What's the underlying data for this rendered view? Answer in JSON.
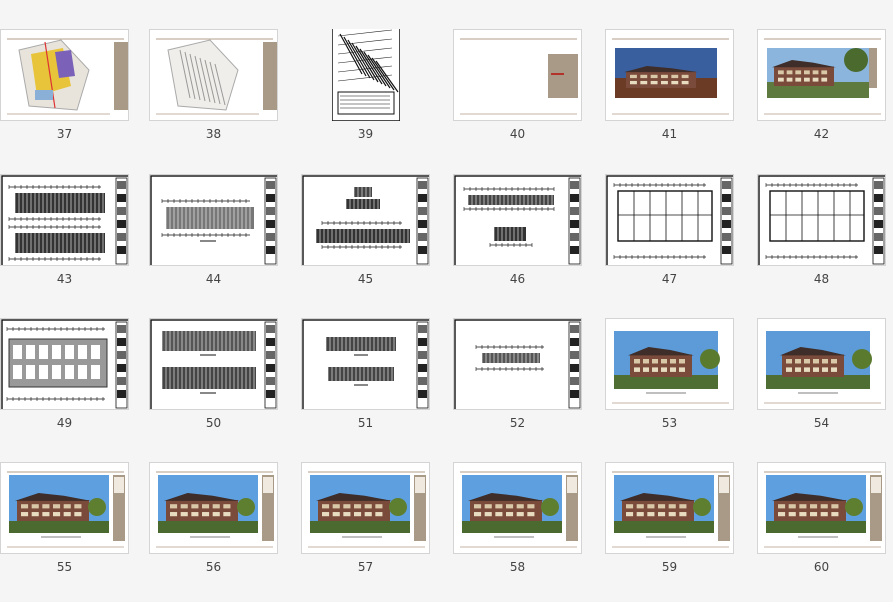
{
  "files": [
    {
      "label": "37",
      "kind": "siteplan"
    },
    {
      "label": "38",
      "kind": "siteplan-gray"
    },
    {
      "label": "39",
      "kind": "cad-portrait"
    },
    {
      "label": "40",
      "kind": "blank-cover"
    },
    {
      "label": "41",
      "kind": "photo-dusk"
    },
    {
      "label": "42",
      "kind": "photo-day"
    },
    {
      "label": "43",
      "kind": "cad-plan-double"
    },
    {
      "label": "44",
      "kind": "cad-plan-single"
    },
    {
      "label": "45",
      "kind": "cad-elevation"
    },
    {
      "label": "46",
      "kind": "cad-elevation-small"
    },
    {
      "label": "47",
      "kind": "cad-floorplan"
    },
    {
      "label": "48",
      "kind": "cad-floorplan"
    },
    {
      "label": "49",
      "kind": "cad-plan-gray"
    },
    {
      "label": "50",
      "kind": "cad-elevation-double"
    },
    {
      "label": "51",
      "kind": "cad-elevation-small2"
    },
    {
      "label": "52",
      "kind": "cad-elevation-tiny"
    },
    {
      "label": "53",
      "kind": "render-villa"
    },
    {
      "label": "54",
      "kind": "render-villa"
    },
    {
      "label": "55",
      "kind": "render-villa-band"
    },
    {
      "label": "56",
      "kind": "render-villa-band"
    },
    {
      "label": "57",
      "kind": "render-villa-band"
    },
    {
      "label": "58",
      "kind": "render-villa-band"
    },
    {
      "label": "59",
      "kind": "render-villa-band"
    },
    {
      "label": "60",
      "kind": "render-villa-band"
    }
  ],
  "colors": {
    "background": "#f5f5f5",
    "tan_band": "#a89a86",
    "accent_red": "#b3322a",
    "sky": "#4a8fd6"
  }
}
